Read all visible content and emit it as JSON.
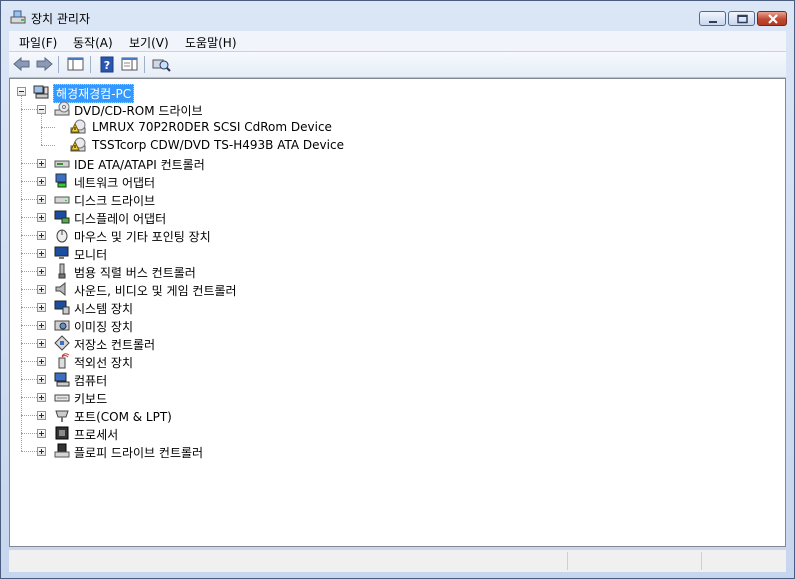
{
  "window": {
    "title": "장치 관리자"
  },
  "menu": [
    "파일(F)",
    "동작(A)",
    "보기(V)",
    "도움말(H)"
  ],
  "toolbar_icons": [
    "back-arrow-icon",
    "forward-arrow-icon",
    "show-hide-console-tree-icon",
    "help-icon",
    "properties-pane-icon",
    "scan-hardware-icon"
  ],
  "tree": {
    "root": "해경재경컴-PC",
    "categories": [
      {
        "label": "DVD/CD-ROM 드라이브",
        "expanded": true,
        "icon": "dvd-drive-icon",
        "children": [
          "LMRUX 70P2R0DER SCSI CdRom Device",
          "TSSTcorp CDW/DVD TS-H493B ATA Device"
        ]
      },
      {
        "label": "IDE ATA/ATAPI 컨트롤러",
        "icon": "ide-controller-icon"
      },
      {
        "label": "네트워크 어댑터",
        "icon": "network-adapter-icon"
      },
      {
        "label": "디스크 드라이브",
        "icon": "disk-drive-icon"
      },
      {
        "label": "디스플레이 어댑터",
        "icon": "display-adapter-icon"
      },
      {
        "label": "마우스 및 기타 포인팅 장치",
        "icon": "mouse-icon"
      },
      {
        "label": "모니터",
        "icon": "monitor-icon"
      },
      {
        "label": "범용 직렬 버스 컨트롤러",
        "icon": "usb-controller-icon"
      },
      {
        "label": "사운드, 비디오 및 게임 컨트롤러",
        "icon": "speaker-icon"
      },
      {
        "label": "시스템 장치",
        "icon": "system-device-icon"
      },
      {
        "label": "이미징 장치",
        "icon": "imaging-device-icon"
      },
      {
        "label": "저장소 컨트롤러",
        "icon": "storage-controller-icon"
      },
      {
        "label": "적외선 장치",
        "icon": "infrared-device-icon"
      },
      {
        "label": "컴퓨터",
        "icon": "computer-icon"
      },
      {
        "label": "키보드",
        "icon": "keyboard-icon"
      },
      {
        "label": "포트(COM & LPT)",
        "icon": "port-icon"
      },
      {
        "label": "프로세서",
        "icon": "processor-icon"
      },
      {
        "label": "플로피 드라이브 컨트롤러",
        "icon": "floppy-controller-icon"
      }
    ]
  },
  "colors": {
    "selection": "#3399ff",
    "frame": "#c9d8ee"
  }
}
